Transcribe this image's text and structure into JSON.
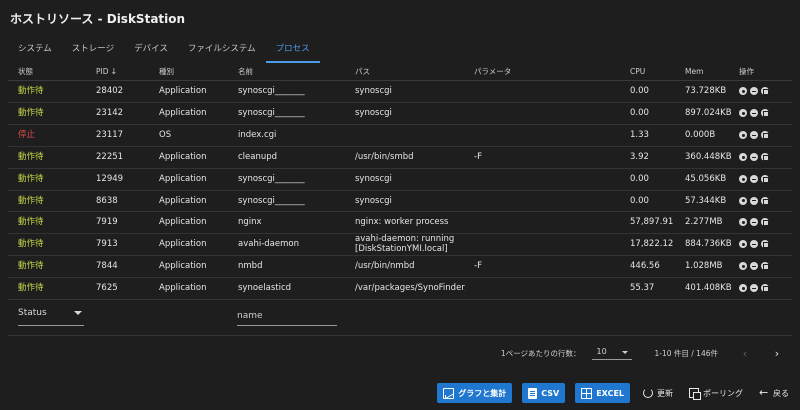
{
  "window": {
    "title": "ホストリソース - DiskStation"
  },
  "tabs": [
    {
      "label": "システム",
      "active": false
    },
    {
      "label": "ストレージ",
      "active": false
    },
    {
      "label": "デバイス",
      "active": false
    },
    {
      "label": "ファイルシステム",
      "active": false
    },
    {
      "label": "プロセス",
      "active": true
    }
  ],
  "table": {
    "headers": {
      "status": "状態",
      "pid": "PID",
      "type": "種別",
      "name": "名前",
      "path": "パス",
      "params": "パラメータ",
      "cpu": "CPU",
      "mem": "Mem",
      "ops": "操作"
    },
    "sort_icon": "arrow-down-icon",
    "rows": [
      {
        "status": "動作待",
        "pid": "28402",
        "type": "Application",
        "name": "synoscgi_______",
        "path": "synoscgi",
        "params": "",
        "cpu": "0.00",
        "mem": "73.728KB"
      },
      {
        "status": "動作待",
        "pid": "23142",
        "type": "Application",
        "name": "synoscgi_______",
        "path": "synoscgi",
        "params": "",
        "cpu": "0.00",
        "mem": "897.024KB"
      },
      {
        "status": "停止",
        "pid": "23117",
        "type": "OS",
        "name": "index.cgi",
        "path": "",
        "params": "",
        "cpu": "1.33",
        "mem": "0.000B"
      },
      {
        "status": "動作待",
        "pid": "22251",
        "type": "Application",
        "name": "cleanupd",
        "path": "/usr/bin/smbd",
        "params": "-F",
        "cpu": "3.92",
        "mem": "360.448KB"
      },
      {
        "status": "動作待",
        "pid": "12949",
        "type": "Application",
        "name": "synoscgi_______",
        "path": "synoscgi",
        "params": "",
        "cpu": "0.00",
        "mem": "45.056KB"
      },
      {
        "status": "動作待",
        "pid": "8638",
        "type": "Application",
        "name": "synoscgi_______",
        "path": "synoscgi",
        "params": "",
        "cpu": "0.00",
        "mem": "57.344KB"
      },
      {
        "status": "動作待",
        "pid": "7919",
        "type": "Application",
        "name": "nginx",
        "path": "nginx: worker process",
        "params": "",
        "cpu": "57,897.91",
        "mem": "2.277MB"
      },
      {
        "status": "動作待",
        "pid": "7913",
        "type": "Application",
        "name": "avahi-daemon",
        "path": "avahi-daemon: running [DiskStationYMI.local]",
        "params": "",
        "cpu": "17,822.12",
        "mem": "884.736KB"
      },
      {
        "status": "動作待",
        "pid": "7844",
        "type": "Application",
        "name": "nmbd",
        "path": "/usr/bin/nmbd",
        "params": "-F",
        "cpu": "446.56",
        "mem": "1.028MB"
      },
      {
        "status": "動作待",
        "pid": "7625",
        "type": "Application",
        "name": "synoelasticd",
        "path": "/var/packages/SynoFinder/target/sbin/synoelasticd",
        "params": "",
        "cpu": "55.37",
        "mem": "401.408KB"
      }
    ],
    "row_ops": [
      "eye-icon",
      "minimize-icon",
      "maximize-icon"
    ]
  },
  "filters": {
    "status_label": "Status",
    "name_placeholder": "name"
  },
  "pager": {
    "rows_per_page_label": "1ページあたりの行数：",
    "rows_per_page_value": "10",
    "range_label": "1-10 件目 / 146件",
    "prev_icon": "chevron-left-icon",
    "next_icon": "chevron-right-icon"
  },
  "toolbar": {
    "chart_label": "グラフと集計",
    "csv_label": "CSV",
    "excel_label": "EXCEL",
    "refresh_label": "更新",
    "polling_label": "ポーリング",
    "back_label": "戻る"
  },
  "colors": {
    "background": "#1e1e1e",
    "accent": "#4c9be6",
    "button": "#1f77d0",
    "status_wait": "#c8d64a",
    "status_stop": "#e24c4c"
  }
}
